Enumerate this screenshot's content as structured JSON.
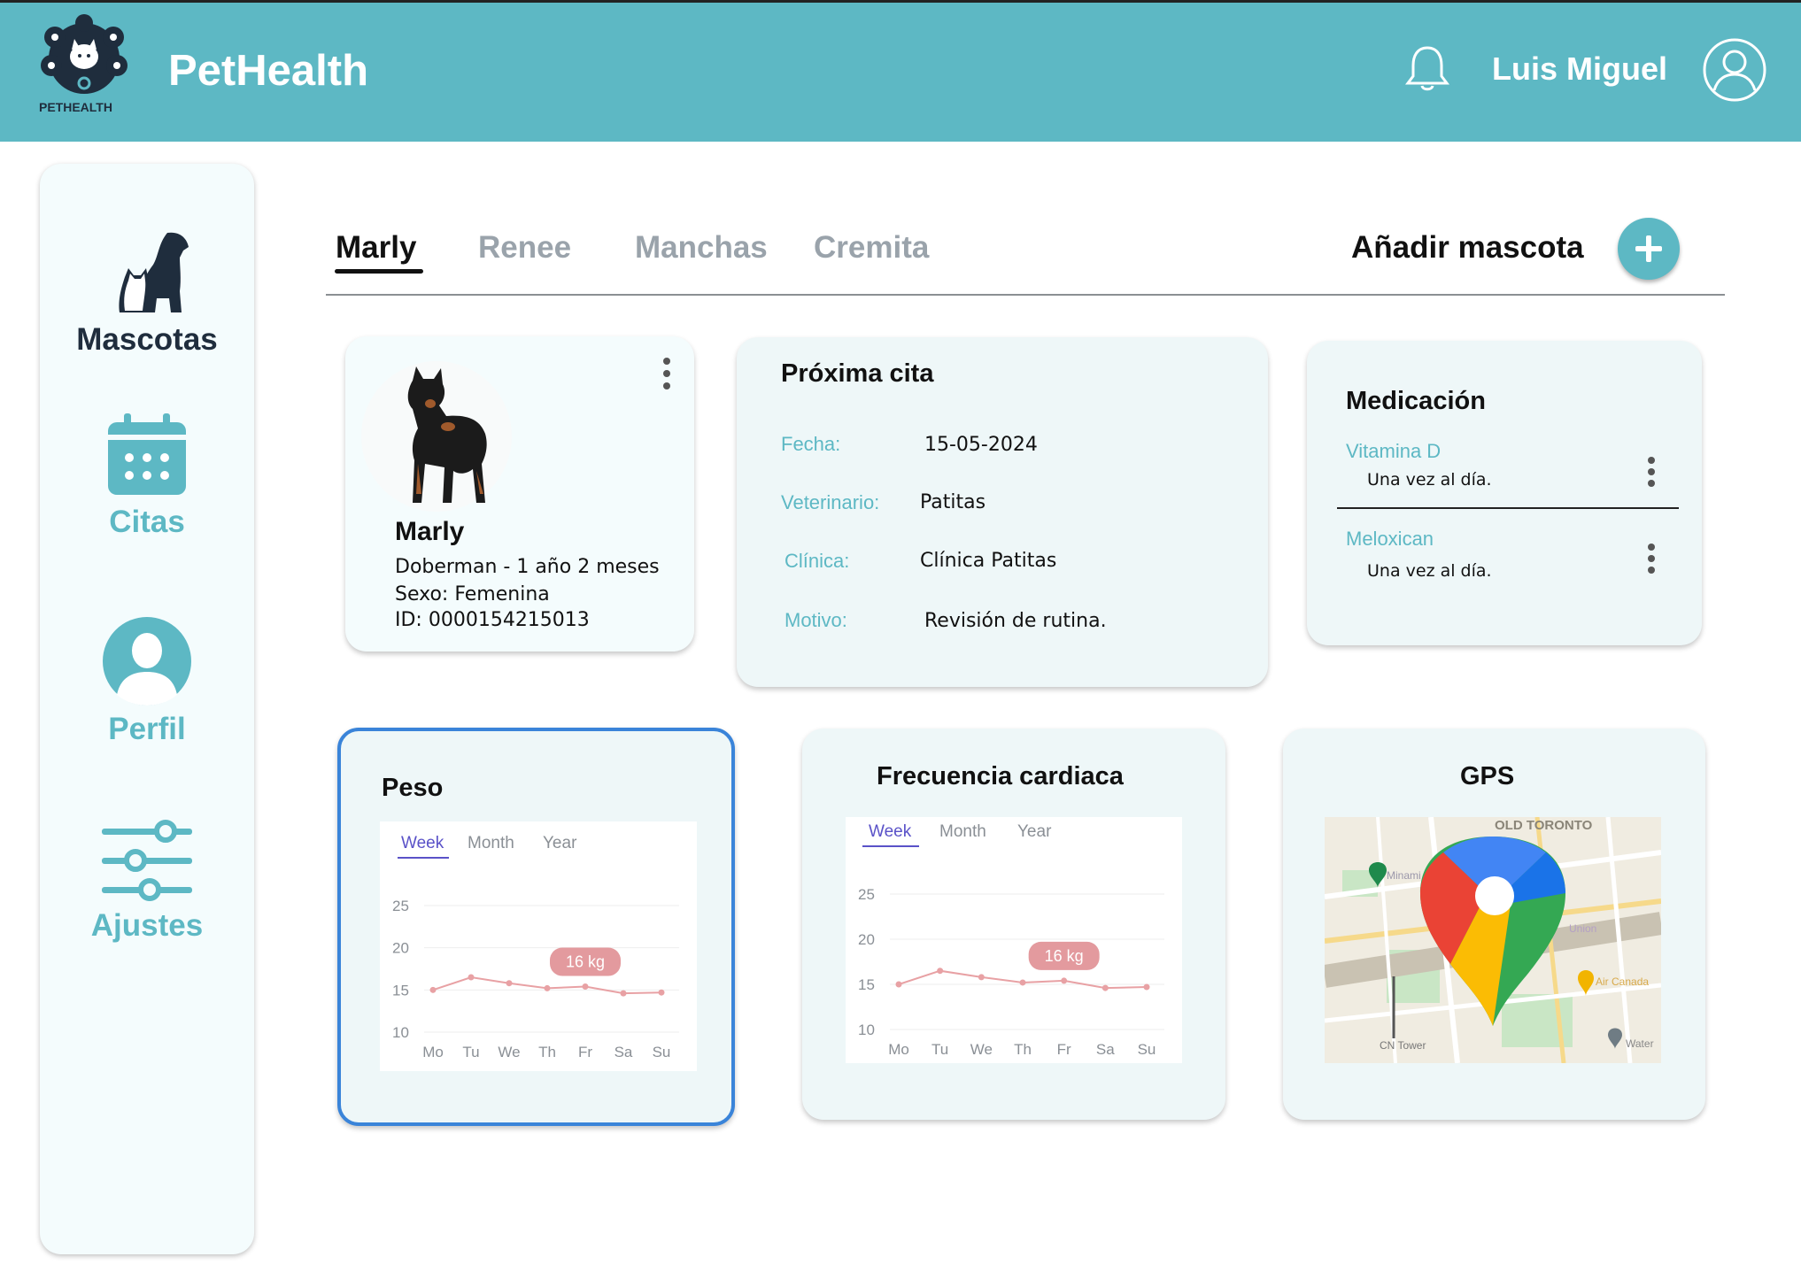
{
  "header": {
    "logo_text": "PETHEALTH",
    "app_title": "PetHealth",
    "user_name": "Luis Miguel"
  },
  "sidebar": {
    "items": [
      {
        "label": "Mascotas",
        "icon": "dog-cat-icon",
        "color": "#1f2d3d",
        "active": true
      },
      {
        "label": "Citas",
        "icon": "calendar-icon",
        "color": "#5db8c4"
      },
      {
        "label": "Perfil",
        "icon": "user-icon",
        "color": "#5db8c4"
      },
      {
        "label": "Ajustes",
        "icon": "sliders-icon",
        "color": "#5db8c4"
      }
    ]
  },
  "tabs": [
    {
      "label": "Marly",
      "active": true
    },
    {
      "label": "Renee"
    },
    {
      "label": "Manchas"
    },
    {
      "label": "Cremita"
    }
  ],
  "add_pet": {
    "label": "Añadir mascota"
  },
  "pet": {
    "name": "Marly",
    "breed_age": "Doberman - 1 año 2 meses",
    "sex": "Sexo: Femenina",
    "id": "ID: 0000154215013"
  },
  "appointment": {
    "title": "Próxima cita",
    "fields": [
      {
        "key": "Fecha:",
        "value": "15-05-2024"
      },
      {
        "key": "Veterinario:",
        "value": "Patitas"
      },
      {
        "key": "Clínica:",
        "value": "Clínica Patitas"
      },
      {
        "key": "Motivo:",
        "value": "Revisión de rutina."
      }
    ]
  },
  "medication": {
    "title": "Medicación",
    "items": [
      {
        "name": "Vitamina D",
        "frequency": "Una vez al día."
      },
      {
        "name": "Meloxican",
        "frequency": "Una vez al día."
      }
    ]
  },
  "weight": {
    "title": "Peso",
    "period_tabs": [
      "Week",
      "Month",
      "Year"
    ],
    "tooltip": "16 kg"
  },
  "heart_rate": {
    "title": "Frecuencia cardiaca",
    "period_tabs": [
      "Week",
      "Month",
      "Year"
    ],
    "tooltip": "16 kg"
  },
  "gps": {
    "title": "GPS",
    "map_labels": [
      "OLD TORONTO",
      "Minami",
      "Union",
      "Air Canada",
      "CN Tower",
      "Water"
    ]
  },
  "chart_data": [
    {
      "type": "line",
      "title": "Peso",
      "categories": [
        "Mo",
        "Tu",
        "We",
        "Th",
        "Fr",
        "Sa",
        "Su"
      ],
      "values": [
        15,
        16.5,
        15.8,
        15.2,
        15.4,
        14.6,
        14.7
      ],
      "yticks": [
        25,
        20,
        15,
        10
      ],
      "ylim": [
        10,
        25
      ],
      "highlight": {
        "label": "16 kg"
      },
      "color": "#e8a1a4",
      "grid": true
    },
    {
      "type": "line",
      "title": "Frecuencia cardiaca",
      "categories": [
        "Mo",
        "Tu",
        "We",
        "Th",
        "Fr",
        "Sa",
        "Su"
      ],
      "values": [
        15,
        16.5,
        15.8,
        15.2,
        15.4,
        14.6,
        14.7
      ],
      "yticks": [
        25,
        20,
        15,
        10
      ],
      "ylim": [
        10,
        25
      ],
      "highlight": {
        "label": "16 kg"
      },
      "color": "#e8a1a4",
      "grid": true
    }
  ]
}
